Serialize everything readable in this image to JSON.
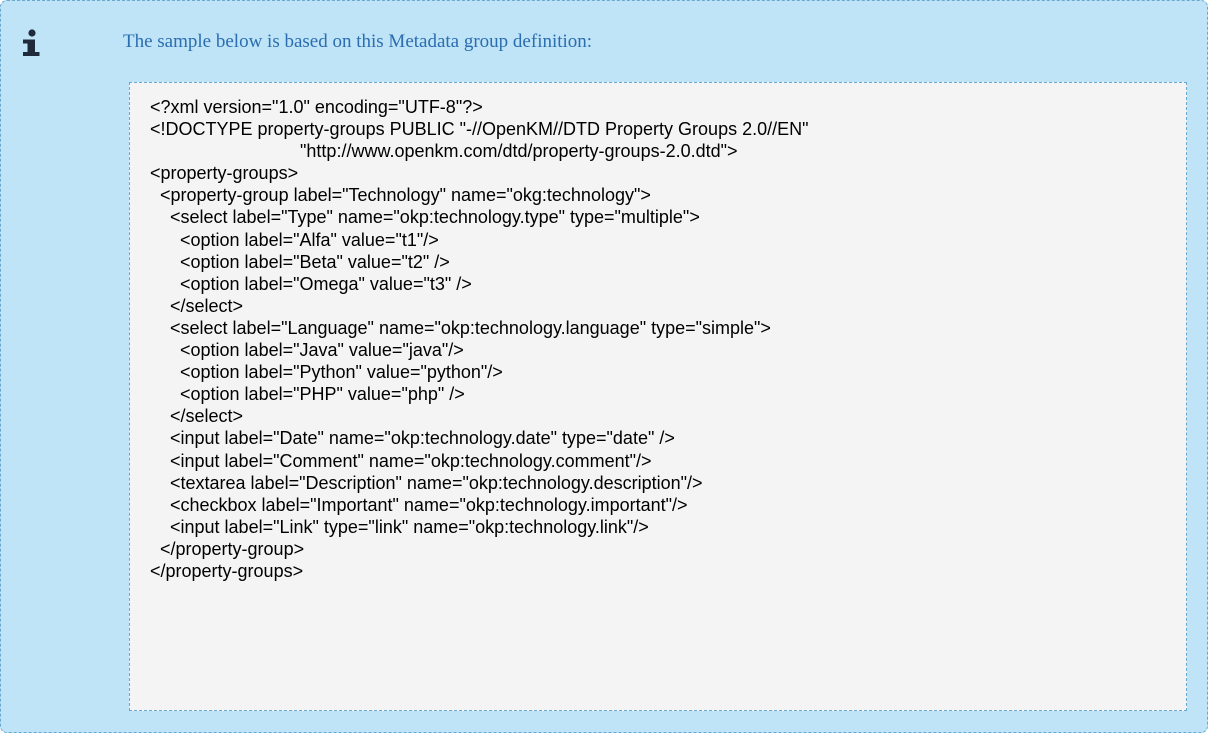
{
  "info": {
    "icon": "info-icon",
    "intro_text": "The sample below is based on this Metadata group definition:"
  },
  "code": {
    "lines": [
      "<?xml version=\"1.0\" encoding=\"UTF-8\"?>",
      "<!DOCTYPE property-groups PUBLIC \"-//OpenKM//DTD Property Groups 2.0//EN\"",
      "                              \"http://www.openkm.com/dtd/property-groups-2.0.dtd\">",
      "<property-groups>",
      "  <property-group label=\"Technology\" name=\"okg:technology\">",
      "    <select label=\"Type\" name=\"okp:technology.type\" type=\"multiple\">",
      "      <option label=\"Alfa\" value=\"t1\"/>",
      "      <option label=\"Beta\" value=\"t2\" />",
      "      <option label=\"Omega\" value=\"t3\" />",
      "    </select>",
      "    <select label=\"Language\" name=\"okp:technology.language\" type=\"simple\">",
      "      <option label=\"Java\" value=\"java\"/>",
      "      <option label=\"Python\" value=\"python\"/>",
      "      <option label=\"PHP\" value=\"php\" />",
      "    </select>",
      "    <input label=\"Date\" name=\"okp:technology.date\" type=\"date\" />",
      "    <input label=\"Comment\" name=\"okp:technology.comment\"/>",
      "    <textarea label=\"Description\" name=\"okp:technology.description\"/>",
      "    <checkbox label=\"Important\" name=\"okp:technology.important\"/>",
      "    <input label=\"Link\" type=\"link\" name=\"okp:technology.link\"/>",
      "  </property-group>",
      "</property-groups>"
    ]
  },
  "colors": {
    "box_background": "#bfe4f7",
    "intro_text": "#2a6db0",
    "icon": "#1f2a3a",
    "code_background": "#f4f4f4"
  }
}
